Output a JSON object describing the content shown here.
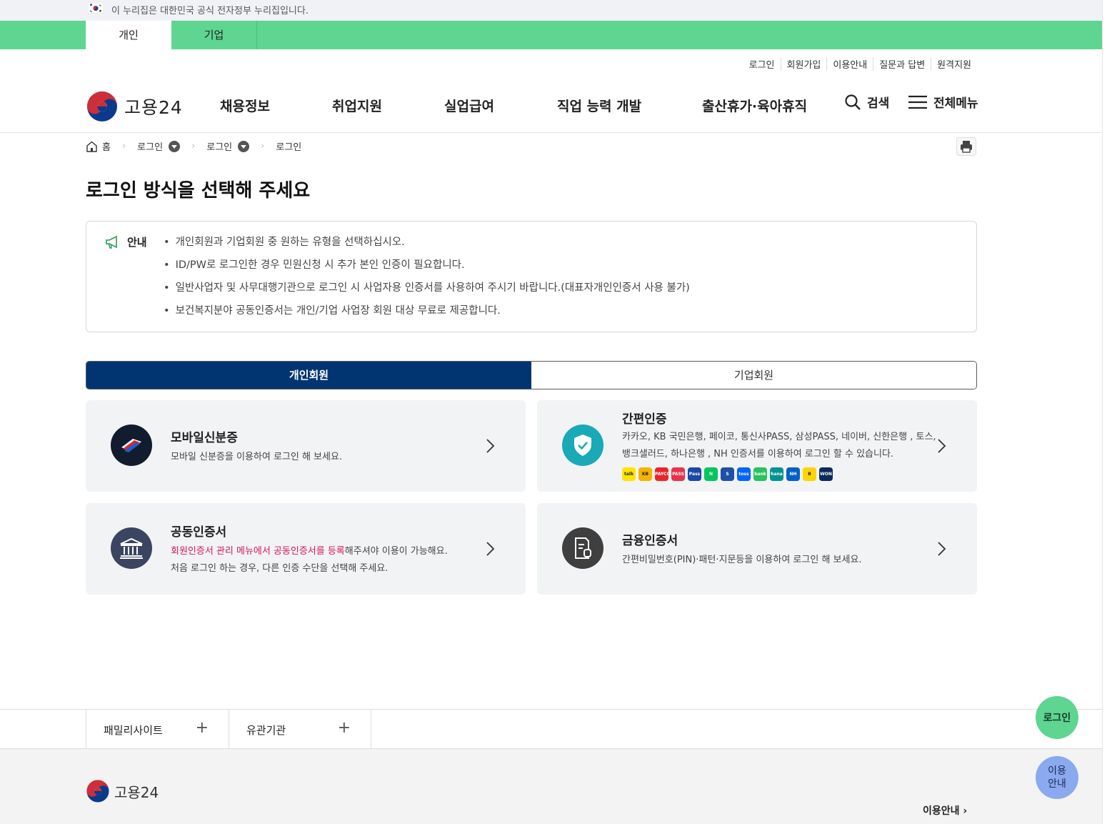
{
  "gov_banner": {
    "text": "이 누리집은 대한민국 공식 전자정부 누리집입니다."
  },
  "type_tabs": [
    "개인",
    "기업"
  ],
  "utility": [
    "로그인",
    "회원가입",
    "이용안내",
    "질문과 답변",
    "원격지원"
  ],
  "logo": {
    "text": "고용24"
  },
  "gnb": {
    "menu": [
      "채용정보",
      "취업지원",
      "실업급여",
      "직업 능력 개발",
      "출산휴가·육아휴직"
    ],
    "search_label": "검색",
    "all_menu_label": "전체메뉴"
  },
  "breadcrumb": [
    "홈",
    "로그인",
    "로그인",
    "로그인"
  ],
  "page_title": "로그인 방식을 선택해 주세요",
  "notice": {
    "label": "안내",
    "items": [
      "개인회원과 기업회원 중 원하는 유형을 선택하십시오.",
      "ID/PW로 로그인한 경우 민원신청 시 추가 본인 인증이 필요합니다.",
      "일반사업자 및 사무대행기관으로 로그인 시 사업자용 인증서를 사용하여 주시기 바랍니다.(대표자개인인증서 사용 불가)",
      "보건복지분야 공동인증서는 개인/기업 사업장 회원 대상 무료로 제공합니다."
    ]
  },
  "member_tabs": {
    "active": "개인회원",
    "inactive": "기업회원"
  },
  "cards": {
    "mobile_id": {
      "title": "모바일신분증",
      "desc": "모바일 신분증을 이용하여 로그인 해 보세요."
    },
    "simple_auth": {
      "title": "간편인증",
      "desc1": "카카오, KB 국민은행, 페이코, 통신사PASS, 삼성PASS, 네이버, 신한은행 , 토스,",
      "desc2": "뱅크샐러드, 하나은행 , NH 인증서를 이용하여 로그인 할 수 있습니다.",
      "brands": [
        "talk",
        "KB",
        "PAYCO",
        "PASS",
        "Pass",
        "N",
        "S",
        "toss",
        "bank",
        "hana",
        "NH",
        "B",
        "WON"
      ],
      "brand_colors": [
        "#fee500",
        "#f4b400",
        "#e8262c",
        "#e8334a",
        "#1a4aa8",
        "#03c75a",
        "#1d50a8",
        "#0064ff",
        "#28c35d",
        "#009490",
        "#0060c7",
        "#ffd400",
        "#0c2a5b"
      ]
    },
    "joint_cert": {
      "title": "공동인증서",
      "desc_emph": "회원인증서 관리 메뉴에서 공동인증서를 등록",
      "desc_rest": "해주셔야 이용이 가능해요.",
      "desc2": "처음 로그인 하는 경우, 다른 인증 수단을 선택해 주세요."
    },
    "financial_cert": {
      "title": "금융인증서",
      "desc": "간편비밀번호(PIN)·패턴·지문등을 이용하여 로그인 해 보세요."
    }
  },
  "footer_links": [
    "패밀리사이트",
    "유관기관"
  ],
  "footer": {
    "logo_text": "고용24",
    "guide": "이용안내"
  },
  "fab": {
    "login": "로그인",
    "guide_line1": "이용",
    "guide_line2": "안내"
  },
  "colors": {
    "green": "#5ed591",
    "navy": "#003571",
    "emphasis": "#d1195a"
  }
}
